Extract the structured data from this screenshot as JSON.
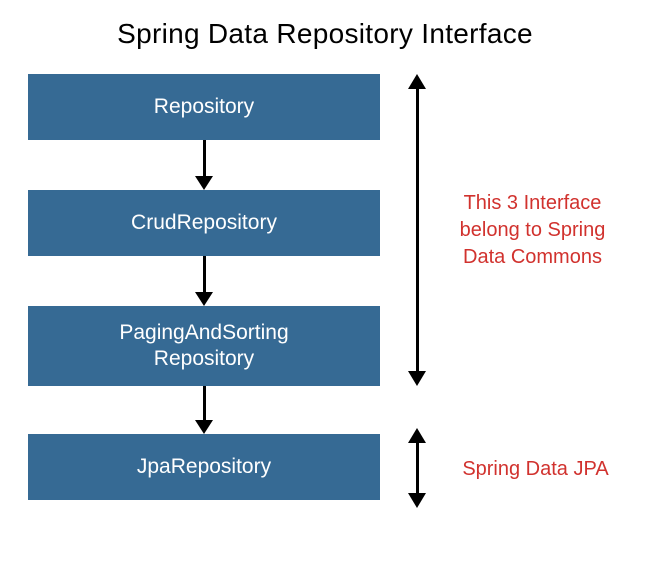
{
  "title": "Spring Data Repository Interface",
  "boxes": {
    "b1": "Repository",
    "b2": "CrudRepository",
    "b3": "PagingAndSorting\nRepository",
    "b4": "JpaRepository"
  },
  "annotations": {
    "group1": "This 3 Interface\nbelong to Spring\nData Commons",
    "group2": "Spring Data JPA"
  },
  "colors": {
    "boxFill": "#366a94",
    "boxText": "#ffffff",
    "annotation": "#d1322e"
  }
}
